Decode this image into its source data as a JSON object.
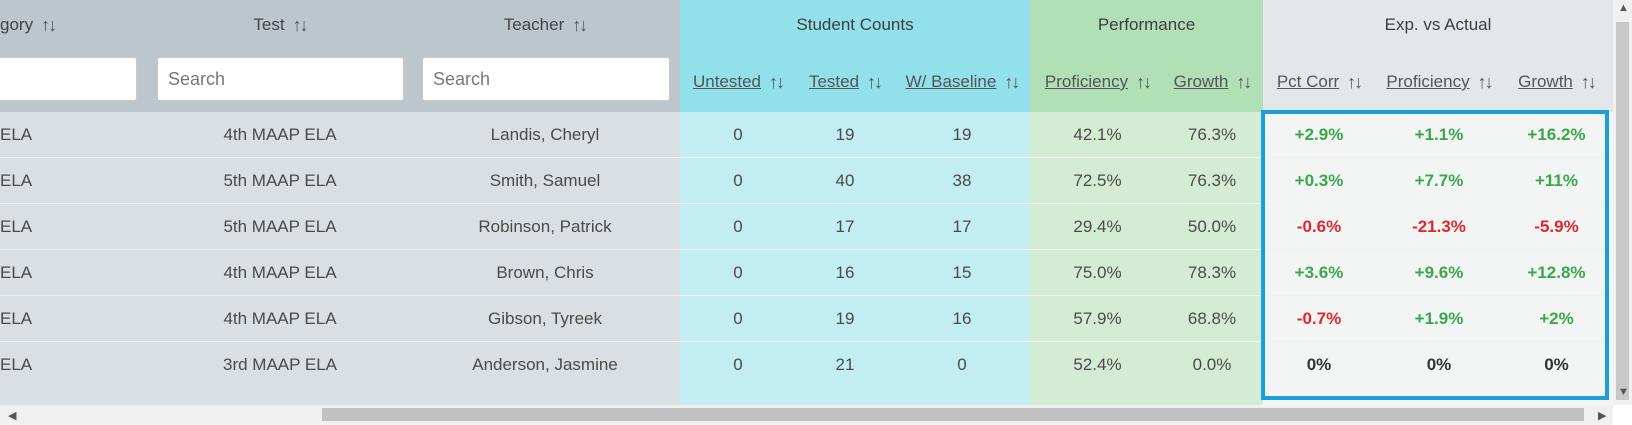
{
  "columns": {
    "category": {
      "label": "gory"
    },
    "test": {
      "label": "Test",
      "search_placeholder": "Search"
    },
    "teacher": {
      "label": "Teacher",
      "search_placeholder": "Search"
    },
    "student_counts": {
      "label": "Student Counts",
      "untested": "Untested",
      "tested": "Tested",
      "baseline": "W/ Baseline"
    },
    "performance": {
      "label": "Performance",
      "proficiency": "Proficiency",
      "growth": "Growth"
    },
    "exp_vs_actual": {
      "label": "Exp. vs Actual",
      "pct_corr": "Pct Corr",
      "proficiency": "Proficiency",
      "growth": "Growth"
    }
  },
  "sort_icon": "↑↓",
  "rows": [
    {
      "category": "ELA",
      "test": "4th MAAP ELA",
      "teacher": "Landis, Cheryl",
      "untested": "0",
      "tested": "19",
      "baseline": "19",
      "proficiency": "42.1%",
      "growth": "76.3%",
      "exp_pct": "+2.9%",
      "exp_prof": "+1.1%",
      "exp_growth": "+16.2%"
    },
    {
      "category": "ELA",
      "test": "5th MAAP ELA",
      "teacher": "Smith, Samuel",
      "untested": "0",
      "tested": "40",
      "baseline": "38",
      "proficiency": "72.5%",
      "growth": "76.3%",
      "exp_pct": "+0.3%",
      "exp_prof": "+7.7%",
      "exp_growth": "+11%"
    },
    {
      "category": "ELA",
      "test": "5th MAAP ELA",
      "teacher": "Robinson, Patrick",
      "untested": "0",
      "tested": "17",
      "baseline": "17",
      "proficiency": "29.4%",
      "growth": "50.0%",
      "exp_pct": "-0.6%",
      "exp_prof": "-21.3%",
      "exp_growth": "-5.9%"
    },
    {
      "category": "ELA",
      "test": "4th MAAP ELA",
      "teacher": "Brown, Chris",
      "untested": "0",
      "tested": "16",
      "baseline": "15",
      "proficiency": "75.0%",
      "growth": "78.3%",
      "exp_pct": "+3.6%",
      "exp_prof": "+9.6%",
      "exp_growth": "+12.8%"
    },
    {
      "category": "ELA",
      "test": "4th MAAP ELA",
      "teacher": "Gibson, Tyreek",
      "untested": "0",
      "tested": "19",
      "baseline": "16",
      "proficiency": "57.9%",
      "growth": "68.8%",
      "exp_pct": "-0.7%",
      "exp_prof": "+1.9%",
      "exp_growth": "+2%"
    },
    {
      "category": "ELA",
      "test": "3rd MAAP ELA",
      "teacher": "Anderson, Jasmine",
      "untested": "0",
      "tested": "21",
      "baseline": "0",
      "proficiency": "52.4%",
      "growth": "0.0%",
      "exp_pct": "0%",
      "exp_prof": "0%",
      "exp_growth": "0%"
    }
  ],
  "colors": {
    "positive": "#3aa84a",
    "negative": "#e0282b",
    "highlight": "#1a9fdd",
    "student_counts_band": "#91e0ea",
    "performance_band": "#b2e0b6"
  }
}
